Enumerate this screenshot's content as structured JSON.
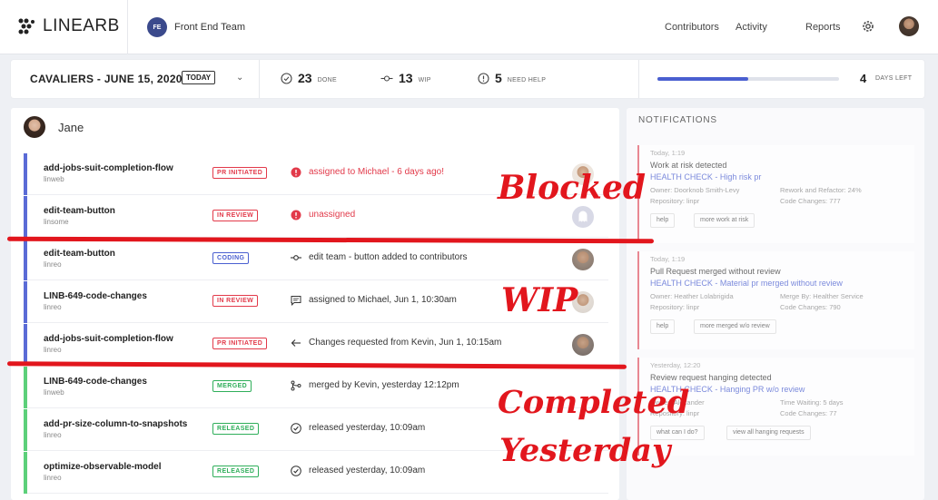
{
  "app": {
    "brand": "LINEARB",
    "team_initials": "FE",
    "team_name": "Front End Team"
  },
  "nav": {
    "contributors": "Contributors",
    "activity": "Activity",
    "reports": "Reports"
  },
  "sprint": {
    "title": "CAVALIERS - JUNE 15, 2020",
    "today_label": "TODAY"
  },
  "stats": {
    "done_num": "23",
    "done_label": "DONE",
    "wip_num": "13",
    "wip_label": "WIP",
    "help_num": "5",
    "help_label": "NEED HELP",
    "days_num": "4",
    "days_label": "DAYS LEFT",
    "days_progress": 0.5
  },
  "user": {
    "name": "Jane"
  },
  "rows": [
    {
      "name": "add-jobs-suit-completion-flow",
      "repo": "linweb",
      "status": "PR INITIATED",
      "activity": "assigned to Michael - 6 days ago!",
      "state": "blocked",
      "icon": "alert-icon"
    },
    {
      "name": "edit-team-button",
      "repo": "linsome",
      "status": "IN REVIEW",
      "activity": "unassigned",
      "state": "blocked",
      "icon": "alert-icon"
    },
    {
      "name": "edit-team-button",
      "repo": "linreo",
      "status": "CODING",
      "activity": "edit team - button added to contributors",
      "state": "wip",
      "icon": "commit-icon"
    },
    {
      "name": "LINB-649-code-changes",
      "repo": "linreo",
      "status": "IN REVIEW",
      "activity": "assigned to Michael,  Jun 1, 10:30am",
      "state": "wip",
      "icon": "comment-icon"
    },
    {
      "name": "add-jobs-suit-completion-flow",
      "repo": "linreo",
      "status": "PR INITIATED",
      "activity": "Changes requested from Kevin, Jun 1, 10:15am",
      "state": "wip",
      "icon": "arrow-left-icon"
    },
    {
      "name": "LINB-649-code-changes",
      "repo": "linweb",
      "status": "MERGED",
      "activity": "merged by Kevin, yesterday 12:12pm",
      "state": "done",
      "icon": "merge-icon"
    },
    {
      "name": "add-pr-size-column-to-snapshots",
      "repo": "linreo",
      "status": "RELEASED",
      "activity": "released yesterday, 10:09am",
      "state": "done",
      "icon": "check-circle-icon"
    },
    {
      "name": "optimize-observable-model",
      "repo": "linreo",
      "status": "RELEASED",
      "activity": "released yesterday, 10:09am",
      "state": "done",
      "icon": "check-circle-icon"
    }
  ],
  "notifications": {
    "title": "NOTIFICATIONS",
    "cards": [
      {
        "time": "Today, 1:19",
        "title": "Work at risk detected",
        "subtitle": "HEALTH CHECK - High risk pr",
        "meta": [
          "Owner: Doorknob Smith-Levy",
          "Rework and Refactor: 24%",
          "Repository: linpr",
          "Code Changes: 777"
        ],
        "buttons": [
          "help",
          "more work at risk"
        ]
      },
      {
        "time": "Today, 1:19",
        "title": "Pull Request merged without review",
        "subtitle": "HEALTH CHECK - Material pr merged without review",
        "meta": [
          "Owner: Heather Lolabrigida",
          "Merge By: Healther Service",
          "Repository: linpr",
          "Code Changes: 790"
        ],
        "buttons": [
          "help",
          "more merged w/o review"
        ]
      },
      {
        "time": "Yesterday, 12:20",
        "title": "Review request hanging detected",
        "subtitle": "HEALTH CHECK - Hanging PR w/o review",
        "meta": [
          "Owner: Alexander",
          "Time Waiting: 5 days",
          "Repository: linpr",
          "Code Changes: 77"
        ],
        "buttons": [
          "what can I do?",
          "view all hanging requests"
        ]
      }
    ]
  },
  "overlays": {
    "blocked": "Blocked",
    "wip": "WIP",
    "completed": "Completed",
    "yesterday": "Yesterday"
  },
  "colors": {
    "accent": "#4a5fd0",
    "blocked": "#e2161d",
    "wip_bar": "#5a6bd6",
    "done_bar": "#5cd07a",
    "alert": "#e23a4a",
    "released": "#2fae5a"
  }
}
